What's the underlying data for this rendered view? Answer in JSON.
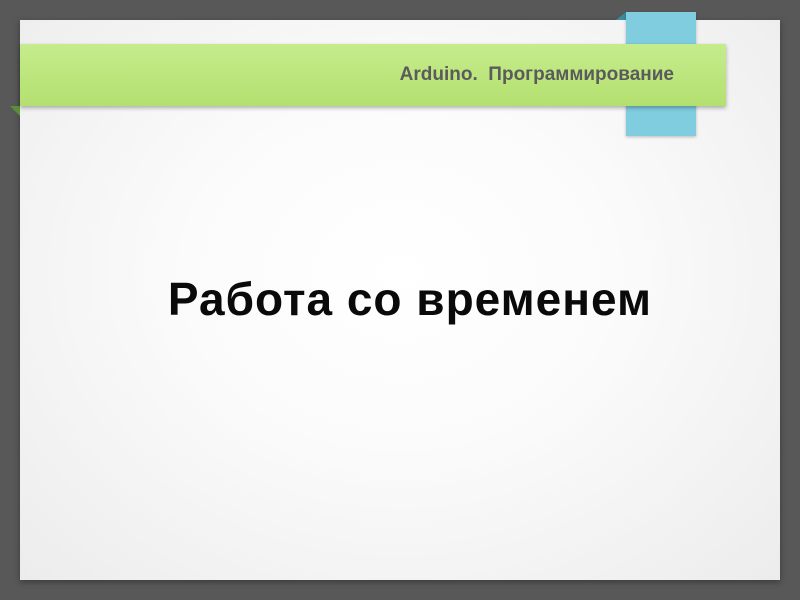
{
  "banner": {
    "title": "Arduino.  Программирование"
  },
  "slide": {
    "heading": "Работа со временем"
  },
  "colors": {
    "background": "#585858",
    "banner": "#b9e57a",
    "bookmark": "#80cde0",
    "heading_text": "#0a0a0a",
    "banner_text": "#5b5b5b"
  }
}
